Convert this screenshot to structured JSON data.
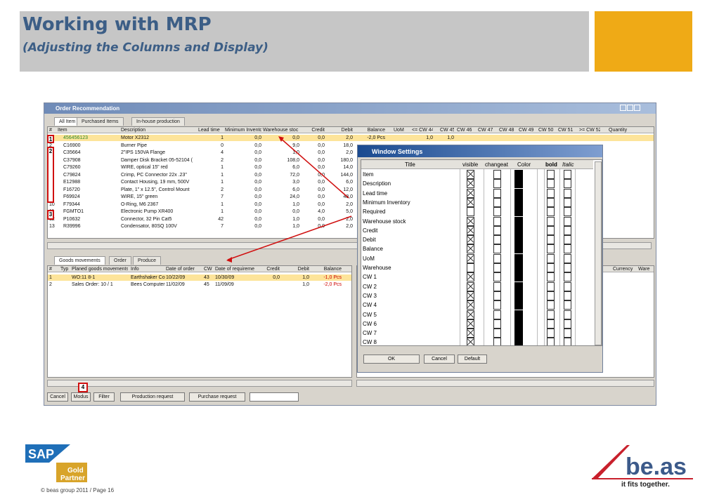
{
  "slide": {
    "title": "Working with MRP",
    "subtitle": "(Adjusting the Columns and Display)",
    "copyright": "© beas group 2011 / Page 16",
    "beas_logo": "be.as",
    "beas_tagline": "it fits together.",
    "sap_logo": "SAP",
    "sap_gold": "Gold",
    "sap_partner": "Partner",
    "accent_color": "#efaa16"
  },
  "window": {
    "title": "Order Recommendation",
    "tabs": [
      "All Item",
      "Purchased Items",
      "In-house production"
    ],
    "columns": [
      "#",
      "Item",
      "Description",
      "Lead time",
      "Minimum Inventory",
      "Warehouse stoc",
      "Credit",
      "Debit",
      "Balance",
      "UoM",
      "<= CW 44",
      "CW 45",
      "CW 46",
      "CW 47",
      "CW 48",
      "CW 49",
      "CW 50",
      "CW 51",
      ">= CW 52",
      "Quantity"
    ],
    "rows": [
      {
        "num": "1",
        "item": "456456123",
        "desc": "Motor X2312",
        "lead": "1",
        "min": "0,0",
        "wh": "0,0",
        "credit": "0,0",
        "debit": "2,0",
        "balance": "-2,0 Pcs",
        "uom": "",
        "cw44": "1,0",
        "cw45": "1,0"
      },
      {
        "num": "2",
        "item": "C16900",
        "desc": "Burner Pipe",
        "lead": "0",
        "min": "0,0",
        "wh": "9,0",
        "credit": "0,0",
        "debit": "18,0"
      },
      {
        "num": "3",
        "item": "C35664",
        "desc": "2\"IPS 150VA Flange",
        "lead": "4",
        "min": "0,0",
        "wh": "1,0",
        "credit": "0,0",
        "debit": "2,0"
      },
      {
        "num": "4",
        "item": "C37908",
        "desc": "Damper Disk Bracket 05-52104 (",
        "lead": "2",
        "min": "0,0",
        "wh": "108,0",
        "credit": "0,0",
        "debit": "180,0"
      },
      {
        "num": "5",
        "item": "C79260",
        "desc": "WIRE, optical 15\" red",
        "lead": "1",
        "min": "0,0",
        "wh": "6,0",
        "credit": "0,0",
        "debit": "14,0"
      },
      {
        "num": "6",
        "item": "C79824",
        "desc": "Crimp, PC Connector 22x .23\"",
        "lead": "1",
        "min": "0,0",
        "wh": "72,0",
        "credit": "0,0",
        "debit": "144,0"
      },
      {
        "num": "7",
        "item": "E12988",
        "desc": "Contact Housing, 19 mm, 500V",
        "lead": "1",
        "min": "0,0",
        "wh": "3,0",
        "credit": "0,0",
        "debit": "6,0"
      },
      {
        "num": "8",
        "item": "F16720",
        "desc": "Plate, 1\" x 12.5\", Control Mount",
        "lead": "2",
        "min": "0,0",
        "wh": "6,0",
        "credit": "0,0",
        "debit": "12,0"
      },
      {
        "num": "9",
        "item": "F69924",
        "desc": "WIRE, 15\" green",
        "lead": "7",
        "min": "0,0",
        "wh": "24,0",
        "credit": "0,0",
        "debit": "48,0"
      },
      {
        "num": "10",
        "item": "F79344",
        "desc": "O-Ring, M6 2367",
        "lead": "1",
        "min": "0,0",
        "wh": "1,0",
        "credit": "0,0",
        "debit": "2,0"
      },
      {
        "num": "11",
        "item": "FGMTO1",
        "desc": "Electronic Pump XR400",
        "lead": "1",
        "min": "0,0",
        "wh": "0,0",
        "credit": "4,0",
        "debit": "5,0"
      },
      {
        "num": "12",
        "item": "P10632",
        "desc": "Connector, 32 Pin Cat5",
        "lead": "42",
        "min": "0,0",
        "wh": "1,0",
        "credit": "0,0",
        "debit": "2,0"
      },
      {
        "num": "13",
        "item": "R39996",
        "desc": "Condensator, 80SQ 100V",
        "lead": "7",
        "min": "0,0",
        "wh": "1,0",
        "credit": "0,0",
        "debit": "2,0"
      }
    ],
    "lower_tabs": [
      "Goods movements",
      "Order",
      "Produce"
    ],
    "lower_columns": [
      "#",
      "Typ",
      "Planed goods movements",
      "Info",
      "Date of order",
      "CW",
      "Date of requireme",
      "Credit",
      "Debit",
      "Balance"
    ],
    "lower_rows": [
      {
        "num": "1",
        "mov": "WO:11 8-1",
        "info": "Earthshaker Co",
        "date": "10/22/09",
        "cw": "43",
        "req": "10/30/09",
        "credit": "0,0",
        "debit": "1,0",
        "balance": "-1,0 Pcs"
      },
      {
        "num": "2",
        "mov": "Sales Order: 10 / 1",
        "info": "Bees Computer",
        "date": "11/02/09",
        "cw": "45",
        "req": "11/09/09",
        "credit": "",
        "debit": "1,0",
        "balance": "-2,0 Pcs"
      }
    ],
    "right_lower_cols": [
      "Currency",
      "Ware"
    ],
    "buttons": [
      "Cancel",
      "Modus",
      "Filter",
      "Production request",
      "Purchase request"
    ],
    "badges": [
      "1",
      "2",
      "3",
      "4"
    ]
  },
  "dialog": {
    "title": "Window Settings",
    "col_title": "Title",
    "col_visible": "visible",
    "col_change": "changeat",
    "col_color": "Color",
    "col_bold": "bold",
    "col_italic": "Italic",
    "rows": [
      {
        "label": "Item",
        "visible": true
      },
      {
        "label": "Description",
        "visible": true
      },
      {
        "label": "Lead time",
        "visible": true
      },
      {
        "label": "Minimum Inventory",
        "visible": true
      },
      {
        "label": "Required",
        "visible": false
      },
      {
        "label": "Warehouse stock",
        "visible": true
      },
      {
        "label": "Credit",
        "visible": true
      },
      {
        "label": "Debit",
        "visible": true
      },
      {
        "label": "Balance",
        "visible": true
      },
      {
        "label": "UoM",
        "visible": true
      },
      {
        "label": "Warehouse",
        "visible": false
      },
      {
        "label": "CW 1",
        "visible": true
      },
      {
        "label": "CW 2",
        "visible": true
      },
      {
        "label": "CW 3",
        "visible": true
      },
      {
        "label": "CW 4",
        "visible": true
      },
      {
        "label": "CW 5",
        "visible": true
      },
      {
        "label": "CW 6",
        "visible": true
      },
      {
        "label": "CW 7",
        "visible": true
      },
      {
        "label": "CW 8",
        "visible": true
      }
    ],
    "ok": "OK",
    "cancel": "Cancel",
    "default": "Default"
  }
}
